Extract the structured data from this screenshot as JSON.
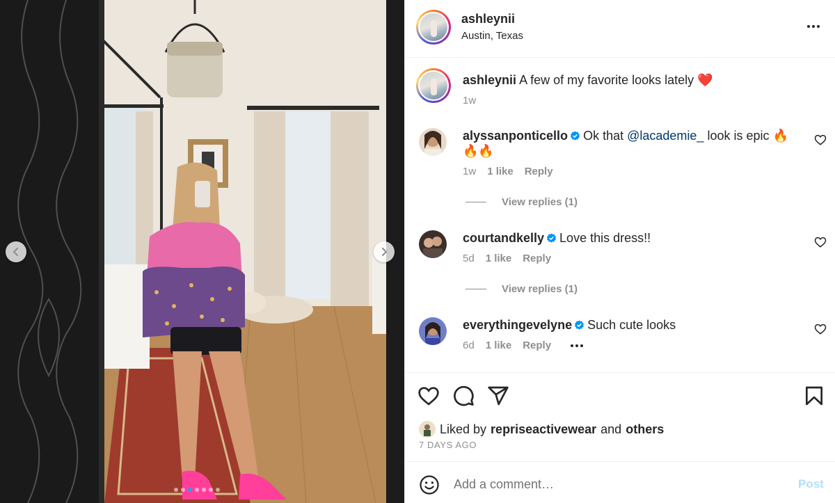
{
  "post": {
    "username": "ashleynii",
    "location": "Austin, Texas",
    "caption": {
      "username": "ashleynii",
      "text": "A few of my favorite looks lately",
      "emoji": "❤️",
      "time": "1w"
    }
  },
  "comments": [
    {
      "username": "alyssanponticello",
      "text_before": "Ok that ",
      "mention": "@lacademie_",
      "text_after": " look is epic 🔥🔥🔥",
      "time": "1w",
      "likes": "1 like",
      "reply": "Reply",
      "view_replies": "View replies (1)"
    },
    {
      "username": "courtandkelly",
      "text": "Love this dress!!",
      "time": "5d",
      "likes": "1 like",
      "reply": "Reply",
      "view_replies": "View replies (1)"
    },
    {
      "username": "everythingevelyne",
      "text": "Such cute looks",
      "time": "6d",
      "likes": "1 like",
      "reply": "Reply"
    }
  ],
  "likes": {
    "prefix": "Liked by",
    "user": "repriseactivewear",
    "and": "and",
    "others": "others",
    "age": "7 DAYS AGO"
  },
  "composer": {
    "placeholder": "Add a comment…",
    "post_label": "Post"
  },
  "carousel": {
    "total": 7,
    "active_index": 2
  },
  "icons": [
    "more-icon",
    "verified-icon",
    "heart-icon",
    "comment-icon",
    "share-icon",
    "bookmark-icon",
    "emoji-icon",
    "chevron-left-icon",
    "chevron-right-icon"
  ],
  "colors": {
    "text": "#262626",
    "secondary": "#8e8e8e",
    "verified": "#0095f6",
    "mention": "#00376b",
    "post_disabled": "#b2dffc",
    "carousel_active": "#3897f0"
  }
}
